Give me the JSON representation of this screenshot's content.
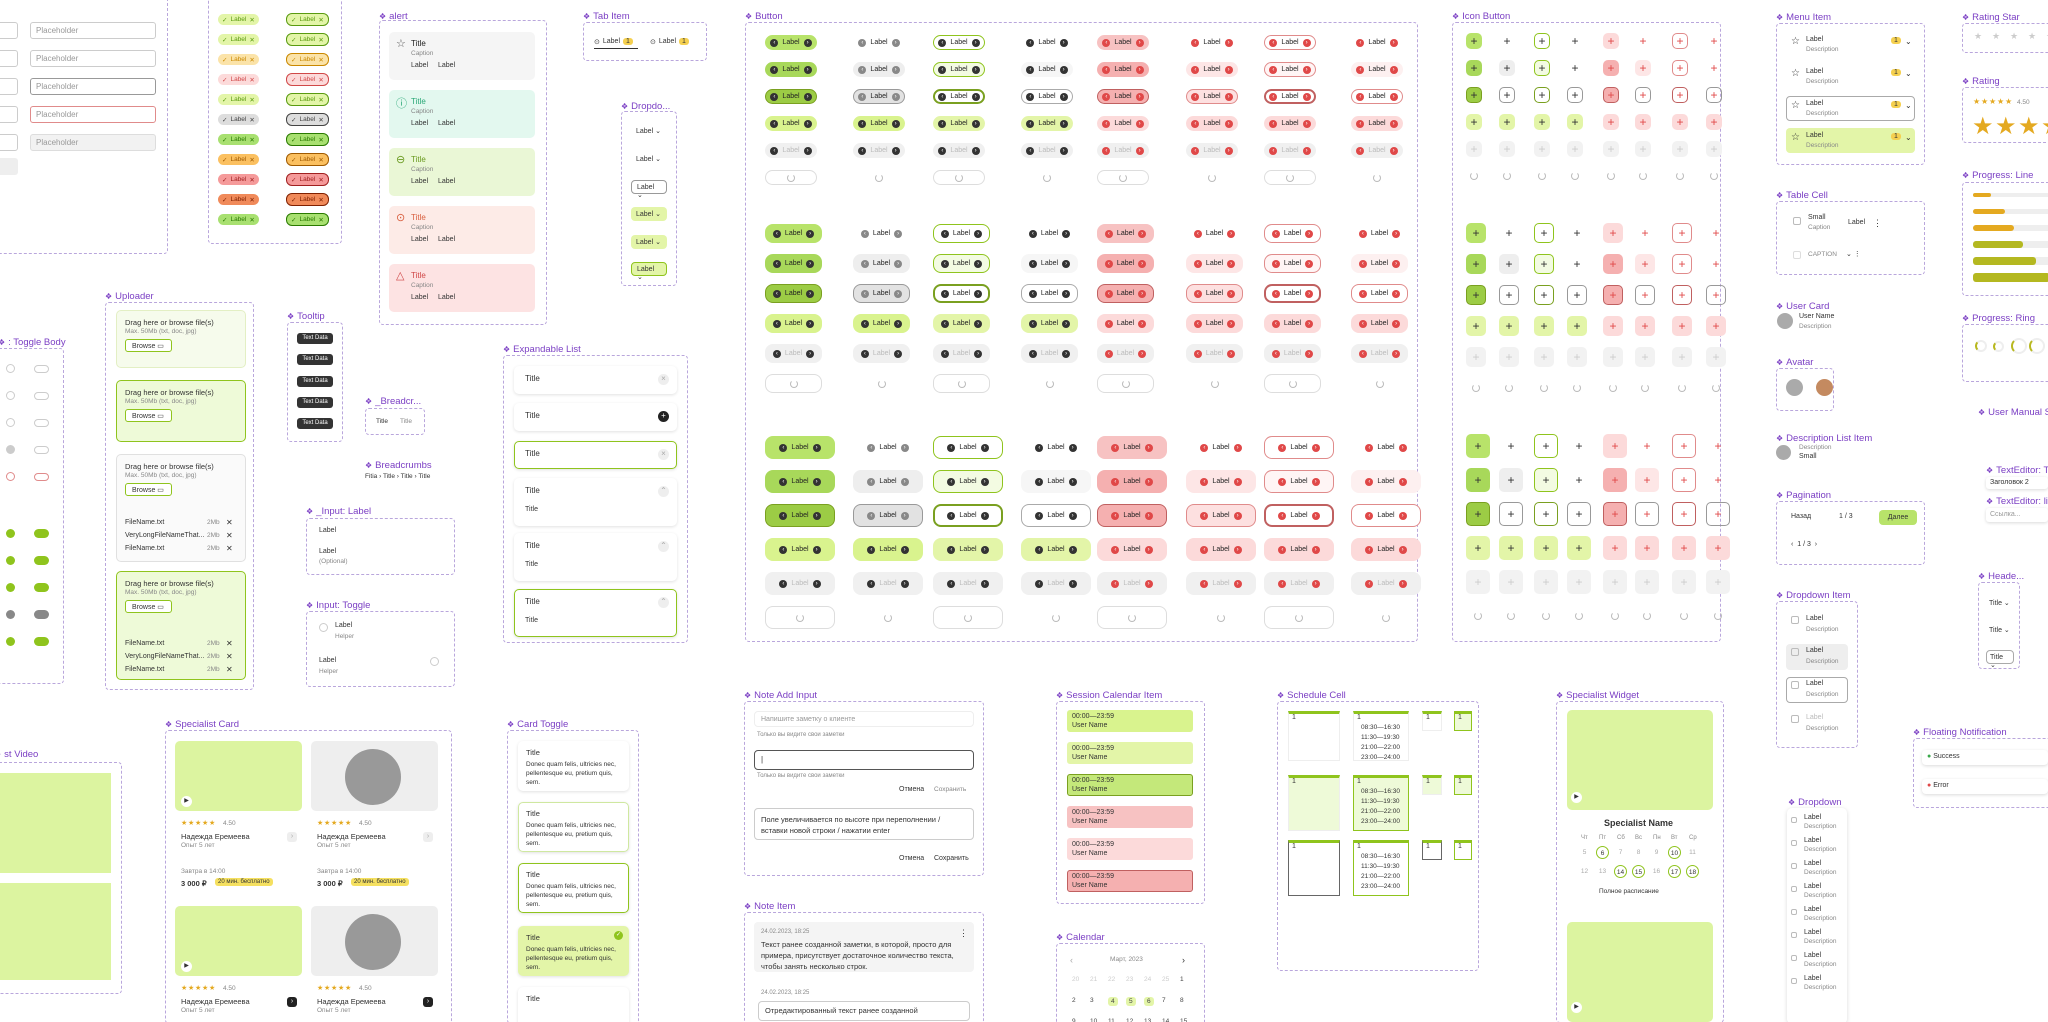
{
  "placeholder": "Placeholder",
  "inputs_left": [
    "Placeholder",
    "Placeholder",
    "Placeholder",
    "Placeholder",
    "Placeholder"
  ],
  "tag_label": "Label",
  "alert": {
    "title": "alert",
    "items": [
      {
        "title": "Title",
        "caption": "Caption",
        "l1": "Label",
        "l2": "Label"
      },
      {
        "title": "Title",
        "caption": "Caption",
        "l1": "Label",
        "l2": "Label"
      },
      {
        "title": "Title",
        "caption": "Caption",
        "l1": "Label",
        "l2": "Label"
      },
      {
        "title": "Title",
        "caption": "Caption",
        "l1": "Label",
        "l2": "Label"
      },
      {
        "title": "Title",
        "caption": "Caption",
        "l1": "Label",
        "l2": "Label"
      }
    ]
  },
  "tab_item": {
    "title": "Tab Item",
    "label": "Label",
    "count": "1"
  },
  "dropdown_small": {
    "title": "Dropdo...",
    "label": "Label"
  },
  "button": {
    "title": "Button",
    "label": "Label"
  },
  "icon_button": {
    "title": "Icon Button",
    "glyph": "+"
  },
  "menu_item": {
    "title": "Menu Item",
    "label": "Label",
    "desc": "Description",
    "count": "1"
  },
  "rating_star": {
    "title": "Rating Star"
  },
  "rating": {
    "title": "Rating",
    "value": "4.50",
    "fraction": 0.9
  },
  "progress_line": {
    "title": "Progress: Line",
    "values": [
      0.2,
      0.35,
      0.45,
      0.55,
      0.7,
      0.85
    ]
  },
  "progress_ring": {
    "title": "Progress: Ring"
  },
  "table_cell": {
    "title": "Table Cell",
    "small": "Small",
    "caption": "Caption",
    "label": "Label",
    "caps": "CAPTION"
  },
  "user_card": {
    "title": "User Card",
    "name": "User Name",
    "desc": "Description"
  },
  "avatar": {
    "title": "Avatar"
  },
  "desc_list": {
    "title": "Description List Item",
    "desc": "Description",
    "small": "Small"
  },
  "pagination": {
    "title": "Pagination",
    "back": "Назад",
    "pages": "1 / 3",
    "next": "Далее",
    "pages2": "1 / 3"
  },
  "dropdown_item": {
    "title": "Dropdown Item",
    "label": "Label",
    "desc": "Description"
  },
  "dropdown": {
    "title": "Dropdown",
    "label": "Label",
    "desc": "Description"
  },
  "user_manual": {
    "title": "User Manual Sc..."
  },
  "texteditor_t": {
    "title": "TextEditor: T",
    "value": "Заголовок 2"
  },
  "texteditor_l": {
    "title": "TextEditor: li",
    "value": "Ссылка..."
  },
  "header": {
    "title": "Heade...",
    "label": "Title"
  },
  "floating": {
    "title": "Floating Notification",
    "success": "Success",
    "error": "Error"
  },
  "toggle_body": {
    "title": ": Toggle Body"
  },
  "uploader": {
    "title": "Uploader",
    "drag": "Drag here or browse file(s)",
    "max": "Max. 50Mb (txt, doc, jpg)",
    "browse": "Browse",
    "files": [
      {
        "name": "FileName.txt",
        "size": "2Mb"
      },
      {
        "name": "VeryLongFileNameThat...",
        "size": "2Mb"
      },
      {
        "name": "FileName.txt",
        "size": "2Mb"
      }
    ]
  },
  "tooltip": {
    "title": "Tooltip",
    "text": "Text Data"
  },
  "breadcr": {
    "title": "_Breadcr...",
    "t1": "Title",
    "t2": "Title"
  },
  "breadcrumbs": {
    "title": "Breadcrumbs",
    "path": "Fitia  ›  Title  ›  Title  ›  Title"
  },
  "input_label": {
    "title": "_Input: Label",
    "label": "Label",
    "label2": "Label",
    "optional": "(Optional)"
  },
  "input_toggle": {
    "title": "Input: Toggle",
    "label": "Label",
    "helper": "Helper"
  },
  "expandable": {
    "title": "Expandable List",
    "item": "Title",
    "sub": "Title"
  },
  "note_add": {
    "title": "Note Add Input",
    "placeholder": "Напишите заметку о клиенте",
    "hint": "Только вы видите свои заметки",
    "cancel": "Отмена",
    "save": "Сохранить",
    "text": "Поле увеличивается по высоте при переполнении / вставки новой строки / нажатии enter"
  },
  "note_item": {
    "title": "Note Item",
    "date": "24.02.2023, 18:25",
    "text": "Текст ранее созданной заметки, в которой, просто для примера, присутствует достаточное количество текста, чтобы занять несколько строк.",
    "date2": "24.02.2023, 18:25",
    "text2": "Отредактированный текст ранее созданной"
  },
  "session": {
    "title": "Session Calendar Item",
    "time": "00:00—23:59",
    "user": "User Name"
  },
  "calendar": {
    "title": "Calendar",
    "month": "Март, 2023"
  },
  "schedule": {
    "title": "Schedule Cell",
    "day": "1",
    "times": [
      "08:30—16:30",
      "11:30—19:30",
      "21:00—22:00",
      "23:00—24:00"
    ]
  },
  "specialist_widget": {
    "title": "Specialist Widget",
    "name": "Specialist Name",
    "days": [
      "Чт",
      "Пт",
      "Сб",
      "Вс",
      "Пн",
      "Вт",
      "Ср"
    ],
    "full": "Полное расписание"
  },
  "specialist_card": {
    "title": "Specialist Card",
    "rating": "4.50",
    "name": "Надежда Еремеева",
    "exp": "Опыт 5 лет",
    "time": "Завтра в 14:00",
    "price": "3 000 ₽",
    "free": "20 мин. бесплатно"
  },
  "card_toggle": {
    "title": "Card Toggle",
    "item": "Title",
    "body": "Donec quam felis, ultricies nec, pellentesque eu, pretium quis, sem."
  },
  "video": {
    "title": "st Video"
  },
  "colors": {
    "accent": "#7b3fc4",
    "green": "#e3f5a8",
    "green_dark": "#8fc41d",
    "red": "#fcdada"
  }
}
